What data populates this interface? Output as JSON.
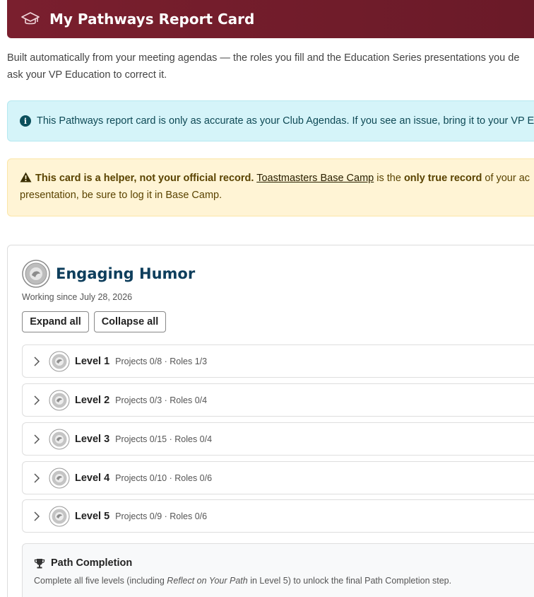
{
  "header": {
    "title": "My Pathways Report Card",
    "icon": "graduation-cap-icon"
  },
  "intro": {
    "line1": "Built automatically from your meeting agendas — the roles you fill and the Education Series presentations you de",
    "line2": "ask your VP Education to correct it."
  },
  "info": {
    "icon": "info-circle-icon",
    "text": "This Pathways report card is only as accurate as your Club Agendas. If you see an issue, bring it to your VP E"
  },
  "warning": {
    "icon": "warning-triangle-icon",
    "bold_lead": "This card is a helper, not your official record.",
    "link_text": "Toastmasters Base Camp",
    "mid_text": "is the",
    "bold_mid": "only true record",
    "tail_text": "of your ac",
    "line2": "presentation, be sure to log it in Base Camp."
  },
  "path": {
    "title": "Engaging Humor",
    "since": "Working since July 28, 2026",
    "expand_label": "Expand all",
    "collapse_label": "Collapse all",
    "levels": [
      {
        "name": "Level 1",
        "meta": "Projects 0/8 · Roles 1/3"
      },
      {
        "name": "Level 2",
        "meta": "Projects 0/3 · Roles 0/4"
      },
      {
        "name": "Level 3",
        "meta": "Projects 0/15 · Roles 0/4"
      },
      {
        "name": "Level 4",
        "meta": "Projects 0/10 · Roles 0/6"
      },
      {
        "name": "Level 5",
        "meta": "Projects 0/9 · Roles 0/6"
      }
    ],
    "completion": {
      "title": "Path Completion",
      "text_before": "Complete all five levels (including",
      "text_italic": "Reflect on Your Path",
      "text_after": "in Level 5) to unlock the final Path Completion step."
    }
  },
  "colors": {
    "header": "#7a1f2e",
    "path_title": "#0e3e5c",
    "info_bg": "#d5f4f9",
    "warn_bg": "#fff4d5"
  }
}
